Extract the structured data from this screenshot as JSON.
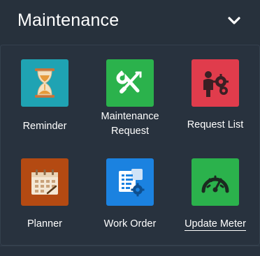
{
  "header": {
    "title": "Maintenance",
    "collapse_icon": "chevron-down-icon"
  },
  "tiles": [
    {
      "label_lines": [
        "Reminder"
      ],
      "icon": "hourglass-icon",
      "color": "#1fa3b3"
    },
    {
      "label_lines": [
        "Maintenance",
        "Request"
      ],
      "icon": "wrench-screwdriver-icon",
      "color": "#2bb24c"
    },
    {
      "label_lines": [
        "Request List"
      ],
      "icon": "person-gears-icon",
      "color": "#e03c4c"
    },
    {
      "label_lines": [
        "Planner"
      ],
      "icon": "calendar-icon",
      "color": "#b44a12"
    },
    {
      "label_lines": [
        "Work Order"
      ],
      "icon": "work-order-icon",
      "color": "#1b82e0"
    },
    {
      "label_lines": [
        "Update Meter"
      ],
      "icon": "gauge-icon",
      "color": "#2bb24c"
    }
  ]
}
